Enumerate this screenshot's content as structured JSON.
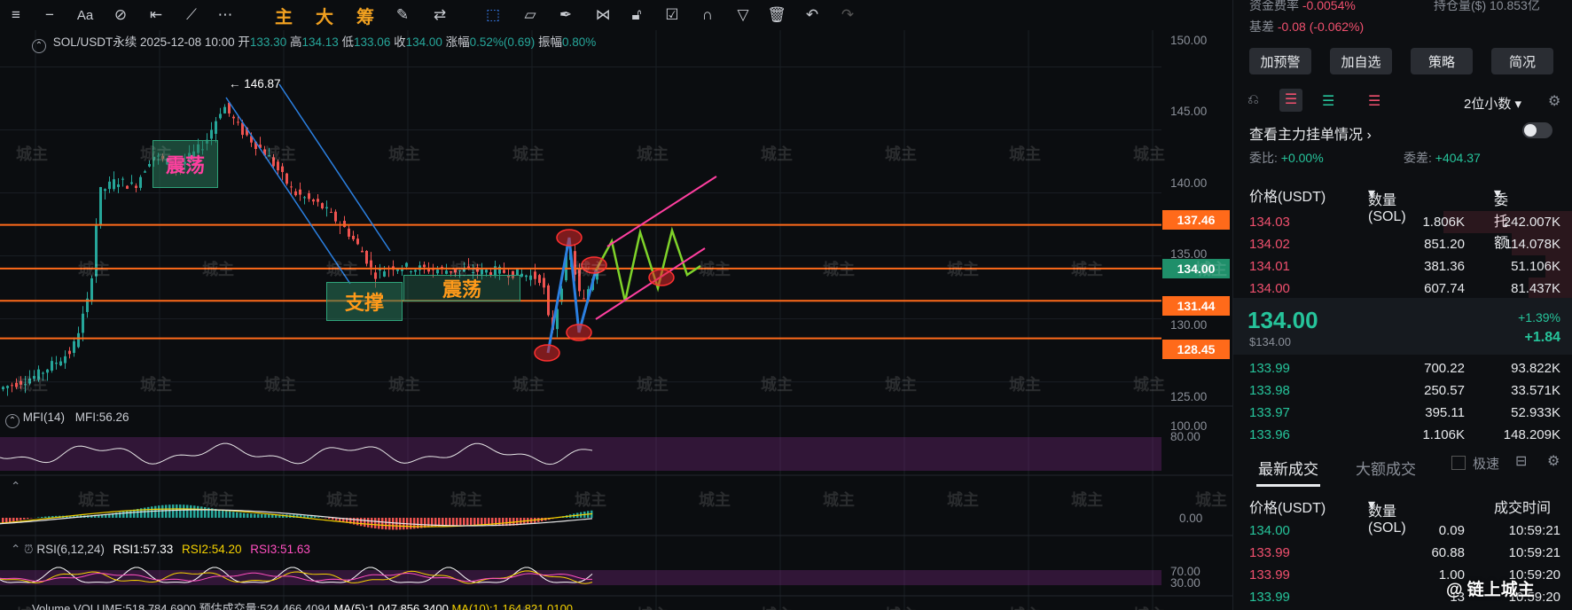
{
  "toolbar": {
    "icons": [
      "menu-icon",
      "minus-icon",
      "text-style-icon",
      "ruler-off-icon",
      "h-line-icon",
      "trend-line-icon",
      "more-icon"
    ],
    "cn_tools": [
      "主",
      "大",
      "筹"
    ],
    "icons2": [
      "edit-icon",
      "swap-icon",
      "cursor-icon",
      "ruler-icon",
      "pen-icon",
      "pattern-icon",
      "lock-icon",
      "note-icon",
      "magnet-icon",
      "filter-icon",
      "trash-icon",
      "undo-icon",
      "redo-icon"
    ]
  },
  "ticker": {
    "symbol": "SOL/USDT永续",
    "datetime": "2025-12-08 10:00",
    "open_label": "开",
    "open": "133.30",
    "high_label": "高",
    "high": "134.13",
    "low_label": "低",
    "low": "133.06",
    "close_label": "收",
    "close": "134.00",
    "change_label": "涨幅",
    "change": "0.52%(0.69)",
    "amp_label": "振幅",
    "amp": "0.80%"
  },
  "chart_data": {
    "type": "candlestick",
    "price_axis": [
      "150.00",
      "145.00",
      "140.00",
      "135.00",
      "130.00",
      "125.00"
    ],
    "ylim": [
      123.5,
      152.5
    ],
    "peak_label": "146.87",
    "levels": [
      {
        "value": 137.46,
        "label": "137.46",
        "color": "#ff6a1a"
      },
      {
        "value": 134.0,
        "label": "134.00",
        "color": "#1f8f6a"
      },
      {
        "value": 131.44,
        "label": "131.44",
        "color": "#ff6a1a"
      },
      {
        "value": 128.45,
        "label": "128.45",
        "color": "#ff6a1a"
      }
    ],
    "annotations": [
      {
        "text": "震荡",
        "color": "#ff3fa0"
      },
      {
        "text": "支撑",
        "color": "#ff9a1a"
      },
      {
        "text": "震荡",
        "color": "#ff9a1a"
      }
    ],
    "mfi": {
      "label": "MFI(14)",
      "value_label": "MFI:56.26",
      "axis": [
        "100.00",
        "80.00"
      ]
    },
    "macd": {
      "axis": [
        "0.00"
      ]
    },
    "rsi": {
      "label": "RSI(6,12,24)",
      "rsi1": "RSI1:57.33",
      "rsi2": "RSI2:54.20",
      "rsi3": "RSI3:51.63",
      "axis": [
        "70.00",
        "30.00"
      ]
    },
    "volume": {
      "label": "Volume",
      "text": "VOLUME:518,784.6900",
      "est": "预估成交量:524,466.4094",
      "ma5": "MA(5):1,047,856.3400",
      "ma10": "MA(10):1,164,821.0100"
    },
    "watermark": "城主"
  },
  "panel": {
    "funding_label": "资金费率",
    "funding": "-0.0054%",
    "position_label": "持仓量($)",
    "position": "10.853亿",
    "basis_label": "基差",
    "basis": "-0.08 (-0.062%)",
    "buttons": [
      "加预警",
      "加自选",
      "策略",
      "简况"
    ],
    "decimals": "2位小数",
    "main_orders": "查看主力挂单情况",
    "wei_bi_label": "委比:",
    "wei_bi": "+0.00%",
    "wei_cha_label": "委差:",
    "wei_cha": "+404.37",
    "book_headers": [
      "价格(USDT)",
      "数量 (SOL)",
      "委托额"
    ],
    "asks": [
      {
        "price": "134.03",
        "qty": "1.806K",
        "amt": "242.007K",
        "depth": 0.38
      },
      {
        "price": "134.02",
        "qty": "851.20",
        "amt": "114.078K",
        "depth": 0.18
      },
      {
        "price": "134.01",
        "qty": "381.36",
        "amt": "51.106K",
        "depth": 0.08
      },
      {
        "price": "134.00",
        "qty": "607.74",
        "amt": "81.437K",
        "depth": 0.13
      }
    ],
    "last_price": "134.00",
    "last_price_sub": "$134.00",
    "last_change_pct": "+1.39%",
    "last_change": "+1.84",
    "bids": [
      {
        "price": "133.99",
        "qty": "700.22",
        "amt": "93.822K"
      },
      {
        "price": "133.98",
        "qty": "250.57",
        "amt": "33.571K"
      },
      {
        "price": "133.97",
        "qty": "395.11",
        "amt": "52.933K"
      },
      {
        "price": "133.96",
        "qty": "1.106K",
        "amt": "148.209K"
      }
    ],
    "trade_tabs": [
      "最新成交",
      "大额成交"
    ],
    "fast_label": "极速",
    "trade_headers": [
      "价格(USDT)",
      "数量(SOL)",
      "成交时间"
    ],
    "trades": [
      {
        "price": "134.00",
        "qty": "0.09",
        "time": "10:59:21",
        "side": "buy"
      },
      {
        "price": "133.99",
        "qty": "60.88",
        "time": "10:59:21",
        "side": "sell"
      },
      {
        "price": "133.99",
        "qty": "1.00",
        "time": "10:59:20",
        "side": "sell"
      },
      {
        "price": "133.99",
        "qty": "13",
        "time": "10:59:20",
        "side": "buy"
      }
    ],
    "brand": "@ 链上城主"
  }
}
